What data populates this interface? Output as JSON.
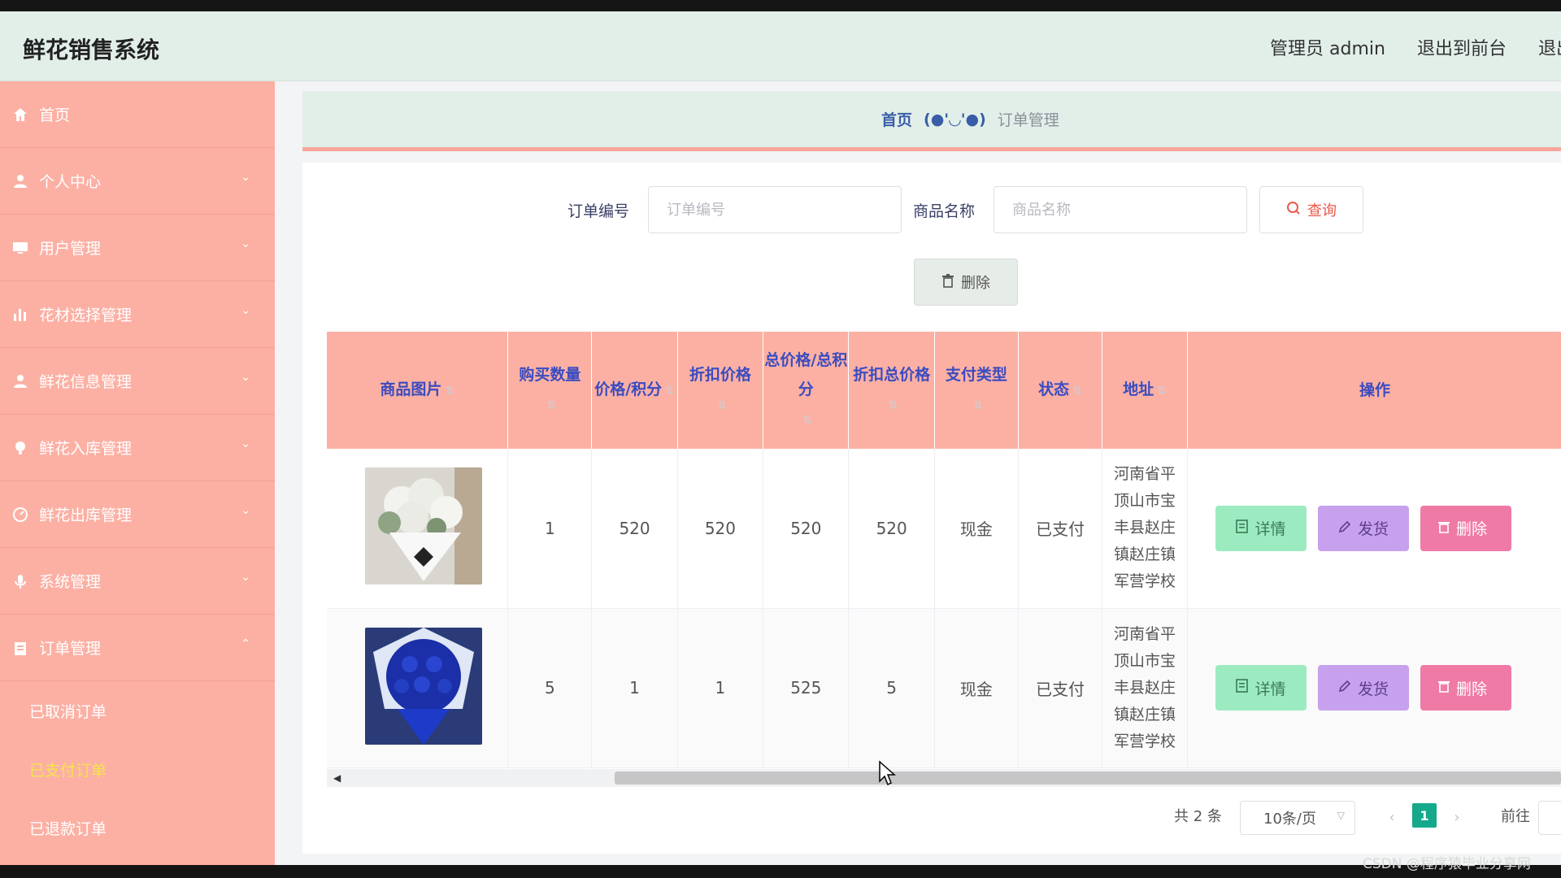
{
  "app": {
    "title": "鲜花销售系统"
  },
  "header": {
    "admin_label": "管理员 admin",
    "front_link": "退出到前台",
    "logout_link": "退出登录"
  },
  "sidebar": {
    "items": [
      {
        "label": "首页",
        "icon": "home-icon"
      },
      {
        "label": "个人中心",
        "icon": "user-icon"
      },
      {
        "label": "用户管理",
        "icon": "monitor-icon"
      },
      {
        "label": "花材选择管理",
        "icon": "bar-chart-icon"
      },
      {
        "label": "鲜花信息管理",
        "icon": "person-icon"
      },
      {
        "label": "鲜花入库管理",
        "icon": "bulb-icon"
      },
      {
        "label": "鲜花出库管理",
        "icon": "gauge-icon"
      },
      {
        "label": "系统管理",
        "icon": "mic-icon"
      },
      {
        "label": "订单管理",
        "icon": "clipboard-icon"
      }
    ],
    "submenu": [
      {
        "label": "已取消订单"
      },
      {
        "label": "已支付订单"
      },
      {
        "label": "已退款订单"
      }
    ]
  },
  "breadcrumb": {
    "home": "首页",
    "separator": "(●'◡'●)",
    "current": "订单管理"
  },
  "search": {
    "order_no_label": "订单编号",
    "order_no_placeholder": "订单编号",
    "product_label": "商品名称",
    "product_placeholder": "商品名称",
    "query_button": "查询",
    "delete_button": "删除"
  },
  "table": {
    "headers": {
      "image": "商品图片",
      "qty": "购买数量",
      "price": "价格/积分",
      "discount_price": "折扣价格",
      "total": "总价格/总积分",
      "discount_total": "折扣总价格",
      "pay_type": "支付类型",
      "status": "状态",
      "address": "地址",
      "actions": "操作"
    },
    "rows": [
      {
        "qty": "1",
        "price": "520",
        "discount_price": "520",
        "total": "520",
        "discount_total": "520",
        "pay_type": "现金",
        "status": "已支付",
        "address": "河南省平顶山市宝丰县赵庄镇赵庄镇军营学校"
      },
      {
        "qty": "5",
        "price": "1",
        "discount_price": "1",
        "total": "525",
        "discount_total": "5",
        "pay_type": "现金",
        "status": "已支付",
        "address": "河南省平顶山市宝丰县赵庄镇赵庄镇军营学校"
      }
    ],
    "actions": {
      "detail": "详情",
      "ship": "发货",
      "delete": "删除"
    }
  },
  "pagination": {
    "total": "共 2 条",
    "page_size": "10条/页",
    "current_page": "1",
    "goto": "前往"
  },
  "watermark": "CSDN @程序猿毕业分享网",
  "colors": {
    "sidebar": "#fcb0a4",
    "header": "#e2efe9",
    "accent": "#13a98a",
    "table_header_text": "#3a4cc0"
  }
}
